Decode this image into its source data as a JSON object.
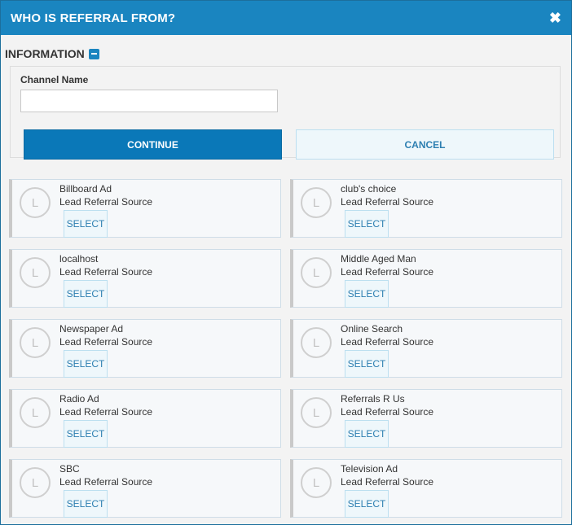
{
  "dialog": {
    "title": "WHO IS REFERRAL FROM?",
    "close_glyph": "✖"
  },
  "section": {
    "title": "INFORMATION"
  },
  "form": {
    "channel_label": "Channel Name",
    "channel_value": "",
    "channel_placeholder": "",
    "continue_label": "CONTINUE",
    "cancel_label": "CANCEL"
  },
  "avatar_letter": "L",
  "channels": [
    {
      "name": "Billboard Ad",
      "type": "Lead Referral Source",
      "select_label": "SELECT"
    },
    {
      "name": "club's choice",
      "type": "Lead Referral Source",
      "select_label": "SELECT"
    },
    {
      "name": "localhost",
      "type": "Lead Referral Source",
      "select_label": "SELECT"
    },
    {
      "name": "Middle Aged Man",
      "type": "Lead Referral Source",
      "select_label": "SELECT"
    },
    {
      "name": "Newspaper Ad",
      "type": "Lead Referral Source",
      "select_label": "SELECT"
    },
    {
      "name": "Online Search",
      "type": "Lead Referral Source",
      "select_label": "SELECT"
    },
    {
      "name": "Radio Ad",
      "type": "Lead Referral Source",
      "select_label": "SELECT"
    },
    {
      "name": "Referrals R Us",
      "type": "Lead Referral Source",
      "select_label": "SELECT"
    },
    {
      "name": "SBC",
      "type": "Lead Referral Source",
      "select_label": "SELECT"
    },
    {
      "name": "Television Ad",
      "type": "Lead Referral Source",
      "select_label": "SELECT"
    }
  ],
  "colors": {
    "header": "#1a85c0",
    "primary_button": "#0a78b8",
    "secondary_button_text": "#2d7fb1"
  }
}
